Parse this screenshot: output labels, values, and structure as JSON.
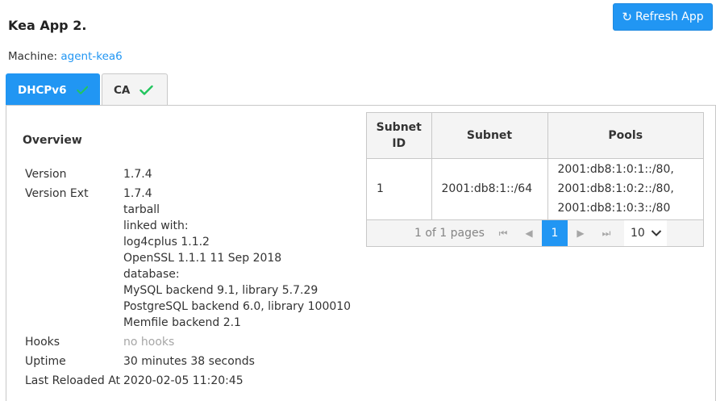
{
  "header": {
    "title": "Kea App 2.",
    "refresh_label": "Refresh App",
    "machine_label": "Machine:",
    "machine_link": "agent-kea6"
  },
  "tabs": [
    {
      "label": "DHCPv6",
      "active": true,
      "status_icon": "check-icon"
    },
    {
      "label": "CA",
      "active": false,
      "status_icon": "check-icon"
    }
  ],
  "overview": {
    "title": "Overview",
    "version_label": "Version",
    "version": "1.7.4",
    "version_ext_label": "Version Ext",
    "version_ext_lines": [
      "1.7.4",
      "tarball",
      "linked with:",
      "log4cplus 1.1.2",
      "OpenSSL 1.1.1 11 Sep 2018",
      "database:",
      "MySQL backend 9.1, library 5.7.29",
      "PostgreSQL backend 6.0, library 100010",
      "Memfile backend 2.1"
    ],
    "hooks_label": "Hooks",
    "hooks": "no hooks",
    "uptime_label": "Uptime",
    "uptime": "30 minutes 38 seconds",
    "last_reloaded_label": "Last Reloaded At",
    "last_reloaded": "2020-02-05 11:20:45"
  },
  "subnets": {
    "columns": [
      "Subnet ID",
      "Subnet",
      "Pools"
    ],
    "rows": [
      {
        "id": "1",
        "subnet": "2001:db8:1::/64",
        "pools": [
          "2001:db8:1:0:1::/80,",
          "2001:db8:1:0:2::/80,",
          "2001:db8:1:0:3::/80"
        ]
      }
    ],
    "paginator": {
      "report": "1 of 1 pages",
      "current_page": "1",
      "rows_per_page": "10"
    }
  },
  "colors": {
    "accent": "#2196f3",
    "check_green": "#22c55e",
    "border": "#c8c8c8",
    "header_bg": "#f4f4f4"
  }
}
